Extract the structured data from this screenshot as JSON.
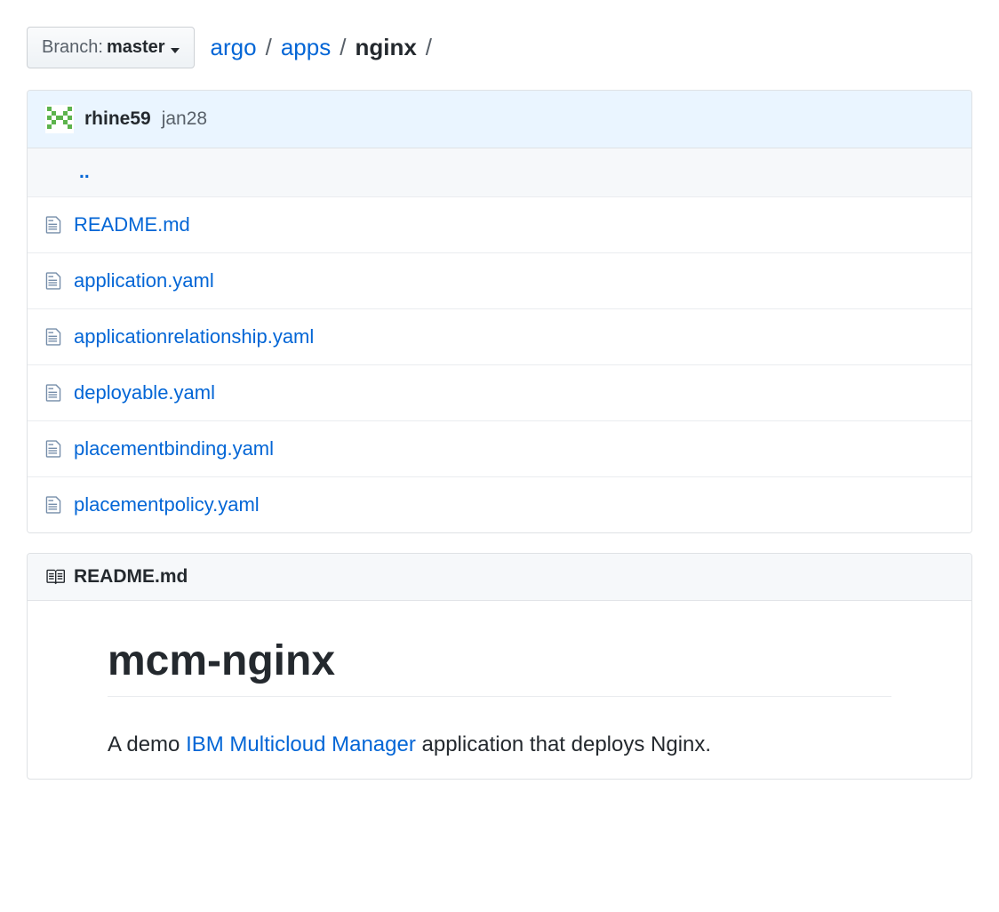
{
  "branch": {
    "prefix": "Branch:",
    "name": "master"
  },
  "breadcrumb": {
    "parts": [
      {
        "label": "argo",
        "link": true
      },
      {
        "label": "apps",
        "link": true
      },
      {
        "label": "nginx",
        "link": false
      }
    ]
  },
  "commit": {
    "author": "rhine59",
    "message": "jan28"
  },
  "updir": "..",
  "files": [
    {
      "name": "README.md"
    },
    {
      "name": "application.yaml"
    },
    {
      "name": "applicationrelationship.yaml"
    },
    {
      "name": "deployable.yaml"
    },
    {
      "name": "placementbinding.yaml"
    },
    {
      "name": "placementpolicy.yaml"
    }
  ],
  "readme": {
    "filename": "README.md",
    "title": "mcm-nginx",
    "desc_pre": "A demo ",
    "desc_link": "IBM Multicloud Manager",
    "desc_post": " application that deploys Nginx."
  }
}
